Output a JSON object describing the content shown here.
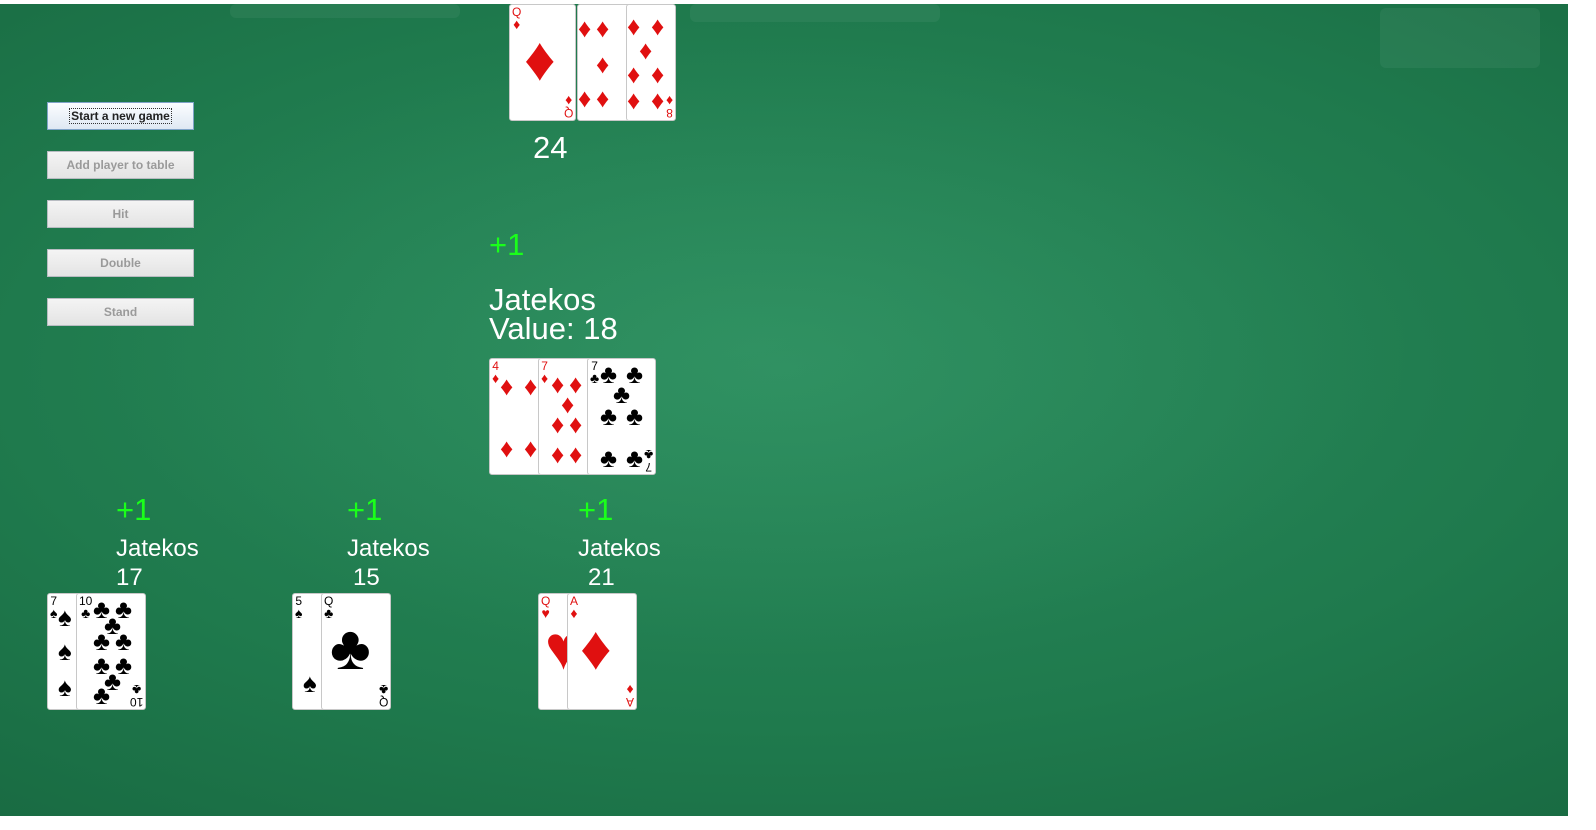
{
  "controls": {
    "start_label": "Start a new game",
    "add_player_label": "Add player to table",
    "hit_label": "Hit",
    "double_label": "Double",
    "stand_label": "Stand"
  },
  "dealer": {
    "value": "24",
    "cards": [
      {
        "rank": "Q",
        "suit": "♦"
      },
      {
        "rank": "9",
        "suit": "♦"
      },
      {
        "rank": "8",
        "suit": "♦"
      }
    ]
  },
  "active_player": {
    "score": "+1",
    "name": "Jatekos",
    "value_label": "Value: 18",
    "cards": [
      {
        "rank": "4",
        "suit": "♦"
      },
      {
        "rank": "7",
        "suit": "♦"
      },
      {
        "rank": "7",
        "suit": "♣"
      }
    ]
  },
  "players": [
    {
      "score": "+1",
      "name": "Jatekos",
      "value": "17",
      "cards": [
        {
          "rank": "7",
          "suit": "♠"
        },
        {
          "rank": "10",
          "suit": "♣"
        }
      ]
    },
    {
      "score": "+1",
      "name": "Jatekos",
      "value": "15",
      "cards": [
        {
          "rank": "5",
          "suit": "♠"
        },
        {
          "rank": "Q",
          "suit": "♣"
        }
      ]
    },
    {
      "score": "+1",
      "name": "Jatekos",
      "value": "21",
      "cards": [
        {
          "rank": "Q",
          "suit": "♥"
        },
        {
          "rank": "A",
          "suit": "♦"
        }
      ]
    }
  ],
  "colors": {
    "felt": "#1f7a4d",
    "score": "#1aff1a",
    "red_suit": "#e01010"
  }
}
